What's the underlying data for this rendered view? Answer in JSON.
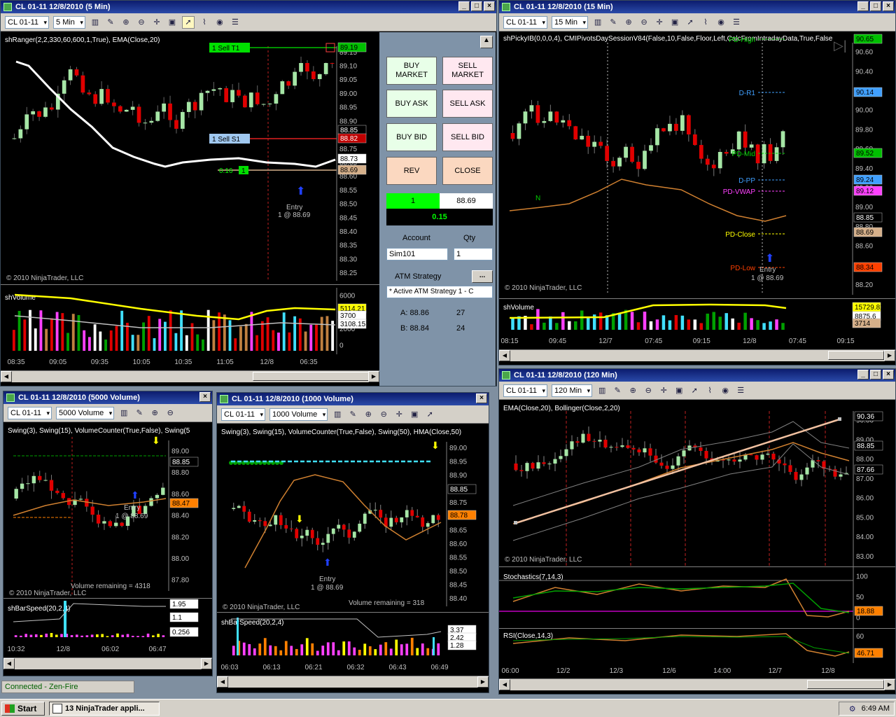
{
  "colors": {
    "up": "#a6e6a6",
    "down": "#e00000",
    "ema": "#ffffff",
    "bg": "#000000",
    "title": "#0c1c6e",
    "axis": "#c0c0c0"
  },
  "win1": {
    "title": "CL 01-11  12/8/2010 (5 Min)",
    "instrument": "CL 01-11",
    "interval": "5 Min",
    "indicator_label": "shRanger(2,2,330,60,600,1,True), EMA(Close,20)",
    "copyright": "© 2010 NinjaTrader, LLC",
    "volume_label": "shVolume",
    "order_sell_t1": "1  Sell T1",
    "order_sell_s1": "1  Sell S1",
    "order_pnl": "0.16",
    "order_qty": "1",
    "entry_label": "Entry",
    "entry_detail": "1 @ 88.69",
    "price_ticks": [
      "89.15",
      "89.10",
      "89.05",
      "89.00",
      "88.95",
      "88.90",
      "88.80",
      "88.75",
      "88.65",
      "88.60",
      "88.55",
      "88.50",
      "88.45",
      "88.40",
      "88.35",
      "88.30",
      "88.25"
    ],
    "price_badges": [
      {
        "text": "89.19",
        "color": "#00c000",
        "fg": "#000"
      },
      {
        "text": "88.85",
        "color": "#000",
        "fg": "#fff"
      },
      {
        "text": "88.82",
        "color": "#c00000",
        "fg": "#fff"
      },
      {
        "text": "88.73",
        "color": "#fff",
        "fg": "#000"
      },
      {
        "text": "88.69",
        "color": "#d6b08a",
        "fg": "#000"
      }
    ],
    "vol_ticks": [
      "6000",
      "4000",
      "2000",
      "0"
    ],
    "vol_badges": [
      {
        "text": "5114.21",
        "color": "#ffff00"
      },
      {
        "text": "3700",
        "color": "#fff"
      },
      {
        "text": "3108.15",
        "color": "#fff"
      }
    ],
    "time_ticks": [
      "08:35",
      "09:05",
      "09:35",
      "10:05",
      "10:35",
      "11:05",
      "12/8",
      "06:35"
    ]
  },
  "trade": {
    "buy_market": "BUY MARKET",
    "sell_market": "SELL MARKET",
    "buy_ask": "BUY ASK",
    "sell_ask": "SELL ASK",
    "buy_bid": "BUY BID",
    "sell_bid": "SELL BID",
    "rev": "REV",
    "close": "CLOSE",
    "position_qty": "1",
    "position_price": "88.69",
    "position_pnl": "0.15",
    "account_label": "Account",
    "qty_label": "Qty",
    "account": "Sim101",
    "qty": "1",
    "atm_label": "ATM Strategy",
    "atm_btn": "...",
    "atm_value": "* Active ATM Strategy 1 - C",
    "ask_label": "A: 88.86",
    "ask_size": "27",
    "bid_label": "B: 88.84",
    "bid_size": "24"
  },
  "win2": {
    "title": "CL 01-11  12/8/2010 (15 Min)",
    "instrument": "CL 01-11",
    "interval": "15 Min",
    "indicator_label": "shPickyIB(0,0,0,4),  CMIPivotsDaySessionV84(False,10,False,Floor,Left,CalcFromIntradayData,True,False",
    "copyright": "© 2010 NinjaTrader, LLC",
    "volume_label": "shVolume",
    "pivots": [
      {
        "text": "PD-High",
        "color": "#00d000"
      },
      {
        "text": "D-R1",
        "color": "#40a0ff"
      },
      {
        "text": "PD-Mid",
        "color": "#00d000"
      },
      {
        "text": "D-PP",
        "color": "#40a0ff"
      },
      {
        "text": "PD-VWAP",
        "color": "#ff40ff"
      },
      {
        "text": "PD-Close",
        "color": "#ffff00"
      },
      {
        "text": "PD-Low",
        "color": "#ff4000"
      }
    ],
    "entry_label": "Entry",
    "entry_detail": "1 @ 88.69",
    "n_label": "N",
    "price_ticks": [
      "90.60",
      "90.40",
      "90.20",
      "90.00",
      "89.80",
      "89.60",
      "89.40",
      "89.20",
      "89.00",
      "88.80",
      "88.60",
      "88.40",
      "88.20"
    ],
    "price_badges": [
      {
        "text": "90.65",
        "color": "#00c000",
        "fg": "#000"
      },
      {
        "text": "90.14",
        "color": "#40a0ff",
        "fg": "#000"
      },
      {
        "text": "89.52",
        "color": "#00c000",
        "fg": "#000"
      },
      {
        "text": "89.24",
        "color": "#40a0ff",
        "fg": "#000"
      },
      {
        "text": "89.12",
        "color": "#ff40ff",
        "fg": "#000"
      },
      {
        "text": "88.85",
        "color": "#000",
        "fg": "#fff"
      },
      {
        "text": "88.69",
        "color": "#d6b08a",
        "fg": "#000"
      },
      {
        "text": "88.34",
        "color": "#ff4000",
        "fg": "#000"
      }
    ],
    "vol_badges": [
      {
        "text": "15729.81",
        "color": "#ffff00"
      },
      {
        "text": "8875.6",
        "color": "#fff"
      },
      {
        "text": "3714",
        "color": "#d6b08a"
      }
    ],
    "time_ticks": [
      "08:15",
      "09:45",
      "12/7",
      "07:45",
      "09:15",
      "12/8",
      "07:45",
      "09:15"
    ]
  },
  "win3": {
    "title": "CL 01-11  12/8/2010 (5000 Volume)",
    "instrument": "CL 01-11",
    "interval": "5000 Volume",
    "indicator_label": "Swing(3), Swing(15), VolumeCounter(True,False), Swing(5",
    "copyright": "© 2010 NinjaTrader, LLC",
    "volume_remaining": "Volume remaining = 4318",
    "entry_label": "Entry",
    "entry_detail": "1 @ 88.69",
    "price_ticks": [
      "89.00",
      "88.80",
      "88.60",
      "88.40",
      "88.20",
      "88.00",
      "87.80"
    ],
    "price_badges": [
      {
        "text": "88.85",
        "color": "#000",
        "fg": "#fff"
      },
      {
        "text": "88.47",
        "color": "#ff8000",
        "fg": "#000"
      }
    ],
    "speed_label": "shBarSpeed(20,2,4)",
    "speed_badges": [
      {
        "text": "1.95"
      },
      {
        "text": "1.1"
      },
      {
        "text": "0.256"
      }
    ],
    "time_ticks": [
      "10:32",
      "12/8",
      "06:02",
      "06:47"
    ]
  },
  "win4": {
    "title": "CL 01-11  12/8/2010 (1000 Volume)",
    "instrument": "CL 01-11",
    "interval": "1000 Volume",
    "indicator_label": "Swing(3), Swing(15), VolumeCounter(True,False), Swing(50), HMA(Close,50)",
    "copyright": "© 2010 NinjaTrader, LLC",
    "volume_remaining": "Volume remaining = 318",
    "entry_label": "Entry",
    "entry_detail": "1 @ 88.69",
    "price_ticks": [
      "89.00",
      "88.95",
      "88.90",
      "88.80",
      "88.75",
      "88.70",
      "88.65",
      "88.60",
      "88.55",
      "88.50",
      "88.45",
      "88.40"
    ],
    "price_badges": [
      {
        "text": "88.85",
        "color": "#000",
        "fg": "#fff"
      },
      {
        "text": "88.78",
        "color": "#ff8000",
        "fg": "#000"
      }
    ],
    "speed_label": "shBarSpeed(20,2,4)",
    "speed_badges": [
      {
        "text": "3.37"
      },
      {
        "text": "2.42"
      },
      {
        "text": "1.28"
      }
    ],
    "time_ticks": [
      "06:03",
      "06:13",
      "06:21",
      "06:32",
      "06:43",
      "06:49"
    ]
  },
  "win5": {
    "title": "CL 01-11  12/8/2010 (120 Min)",
    "instrument": "CL 01-11",
    "interval": "120 Min",
    "indicator_label": "EMA(Close,20), Bollinger(Close,2,20)",
    "copyright": "© 2010 NinjaTrader, LLC",
    "stoch_label": "Stochastics(7,14,3)",
    "rsi_label": "RSI(Close,14,3)",
    "price_ticks": [
      "90.00",
      "89.00",
      "88.00",
      "87.00",
      "86.00",
      "85.00",
      "84.00",
      "83.00"
    ],
    "price_badges": [
      {
        "text": "90.36",
        "color": "#000",
        "fg": "#fff"
      },
      {
        "text": "88.85",
        "color": "#000",
        "fg": "#fff"
      },
      {
        "text": "87.66",
        "color": "#000",
        "fg": "#fff"
      }
    ],
    "stoch_ticks": [
      "100",
      "50",
      "0"
    ],
    "stoch_badge": "18.88",
    "rsi_ticks": [
      "60",
      "40"
    ],
    "rsi_badge": "46.71",
    "time_ticks": [
      "06:00",
      "12/2",
      "12/3",
      "12/6",
      "14:00",
      "12/7",
      "12/8"
    ]
  },
  "status": "Connected - Zen-Fire",
  "taskbar": {
    "start": "Start",
    "item": "13 NinjaTrader appli...",
    "clock": "6:49 AM"
  }
}
